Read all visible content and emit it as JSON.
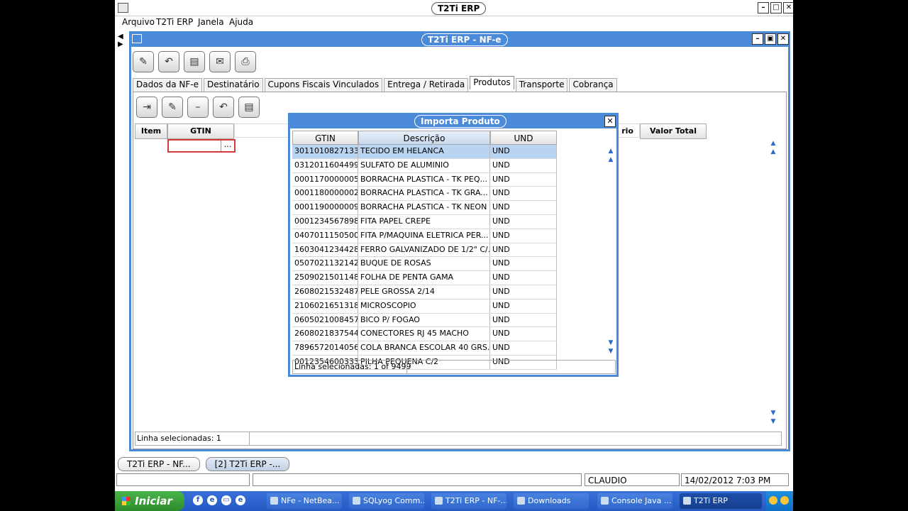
{
  "app": {
    "title": "T2Ti ERP"
  },
  "menu": [
    "Arquivo",
    "T2Ti ERP",
    "Janela",
    "Ajuda"
  ],
  "inner": {
    "title": "T2Ti ERP - NF-e",
    "tabs": [
      "Dados da NF-e",
      "Destinatário",
      "Cupons Fiscais Vinculados",
      "Entrega / Retirada",
      "Produtos",
      "Transporte",
      "Cobrança"
    ],
    "active_tab": "Produtos",
    "grid_headers": [
      "Item",
      "GTIN",
      "rio",
      "Valor Total"
    ],
    "status": "Linha selecionadas: 1",
    "gtin_btn": "..."
  },
  "dialog": {
    "title": "Importa Produto",
    "close": "✕",
    "headers": [
      "GTIN",
      "Descrição",
      "UND"
    ],
    "rows": [
      [
        "3011010827133",
        "TECIDO EM HELANCA",
        "UND"
      ],
      [
        "0312011604499",
        "SULFATO DE ALUMINIO",
        "UND"
      ],
      [
        "0001170000005",
        "BORRACHA PLASTICA - TK PEQ...",
        "UND"
      ],
      [
        "0001180000002",
        "BORRACHA PLASTICA - TK GRA...",
        "UND"
      ],
      [
        "0001190000009",
        "BORRACHA PLASTICA - TK NEON",
        "UND"
      ],
      [
        "0001234567898",
        "FITA PAPEL CREPE",
        "UND"
      ],
      [
        "0407011150500",
        "FITA P/MAQUINA ELETRICA PER...",
        "UND"
      ],
      [
        "1603041234428",
        "FERRO GALVANIZADO DE 1/2\" C/...",
        "UND"
      ],
      [
        "0507021132142",
        "BUQUE DE ROSAS",
        "UND"
      ],
      [
        "2509021501148",
        "FOLHA DE PENTA GAMA",
        "UND"
      ],
      [
        "2608021532487",
        "PELE GROSSA 2/14",
        "UND"
      ],
      [
        "2106021651318",
        "MICROSCOPIO",
        "UND"
      ],
      [
        "0605021008457",
        "BICO P/ FOGAO",
        "UND"
      ],
      [
        "2608021837544",
        "CONECTORES RJ 45 MACHO",
        "UND"
      ],
      [
        "7896572014056",
        "COLA BRANCA ESCOLAR 40 GRS.",
        "UND"
      ],
      [
        "0012354600333",
        "PILHA PEQUENA C/2",
        "UND"
      ]
    ],
    "status": "Linha selecionadas: 1 of 9499"
  },
  "window_tabs": [
    "T2Ti ERP - NF...",
    "[2] T2Ti ERP -..."
  ],
  "statusbar": {
    "user": "CLAUDIO",
    "datetime": "14/02/2012 7:03 PM"
  },
  "taskbar": {
    "start": "Iniciar",
    "tasks": [
      "NFe - NetBea...",
      "SQLyog Comm...",
      "T2Ti ERP - NF-...",
      "Downloads",
      "Console Java ...",
      "T2Ti ERP"
    ]
  }
}
